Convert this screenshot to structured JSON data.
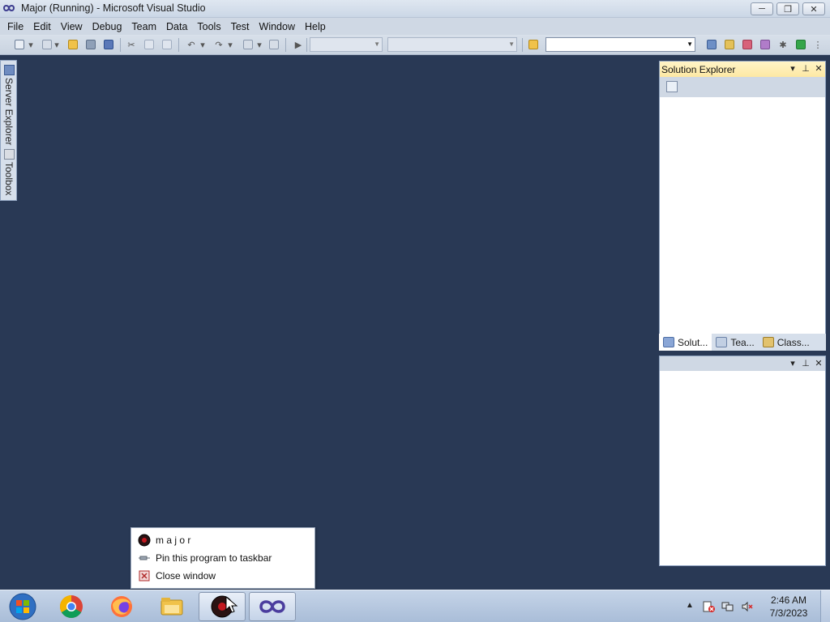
{
  "window": {
    "title": "Major (Running) - Microsoft Visual Studio",
    "controls": {
      "minimize": "─",
      "maximize": "❐",
      "close": "✕"
    }
  },
  "menu": [
    "File",
    "Edit",
    "View",
    "Debug",
    "Team",
    "Data",
    "Tools",
    "Test",
    "Window",
    "Help"
  ],
  "toolbar": {
    "solution_config": "",
    "solution_platform": "",
    "find": ""
  },
  "side_tabs": {
    "server_explorer": "Server Explorer",
    "toolbox": "Toolbox"
  },
  "solution_explorer": {
    "title": "Solution Explorer",
    "tabs": [
      "Solut...",
      "Tea...",
      "Class..."
    ]
  },
  "jump_list": {
    "items": [
      {
        "label": "m a j o r",
        "icon": "major-app-icon"
      },
      {
        "label": "Pin this program to taskbar",
        "icon": "pin-icon"
      },
      {
        "label": "Close window",
        "icon": "close-window-icon"
      }
    ]
  },
  "taskbar": {
    "clock_time": "2:46 AM",
    "clock_date": "7/3/2023",
    "apps": [
      "chrome-icon",
      "firefox-icon",
      "file-explorer-icon",
      "major-app-icon",
      "visual-studio-icon"
    ]
  },
  "colors": {
    "ide_background": "#293955",
    "panel_header_active": "#fde8a3",
    "taskbar": "#b6c8e0"
  }
}
